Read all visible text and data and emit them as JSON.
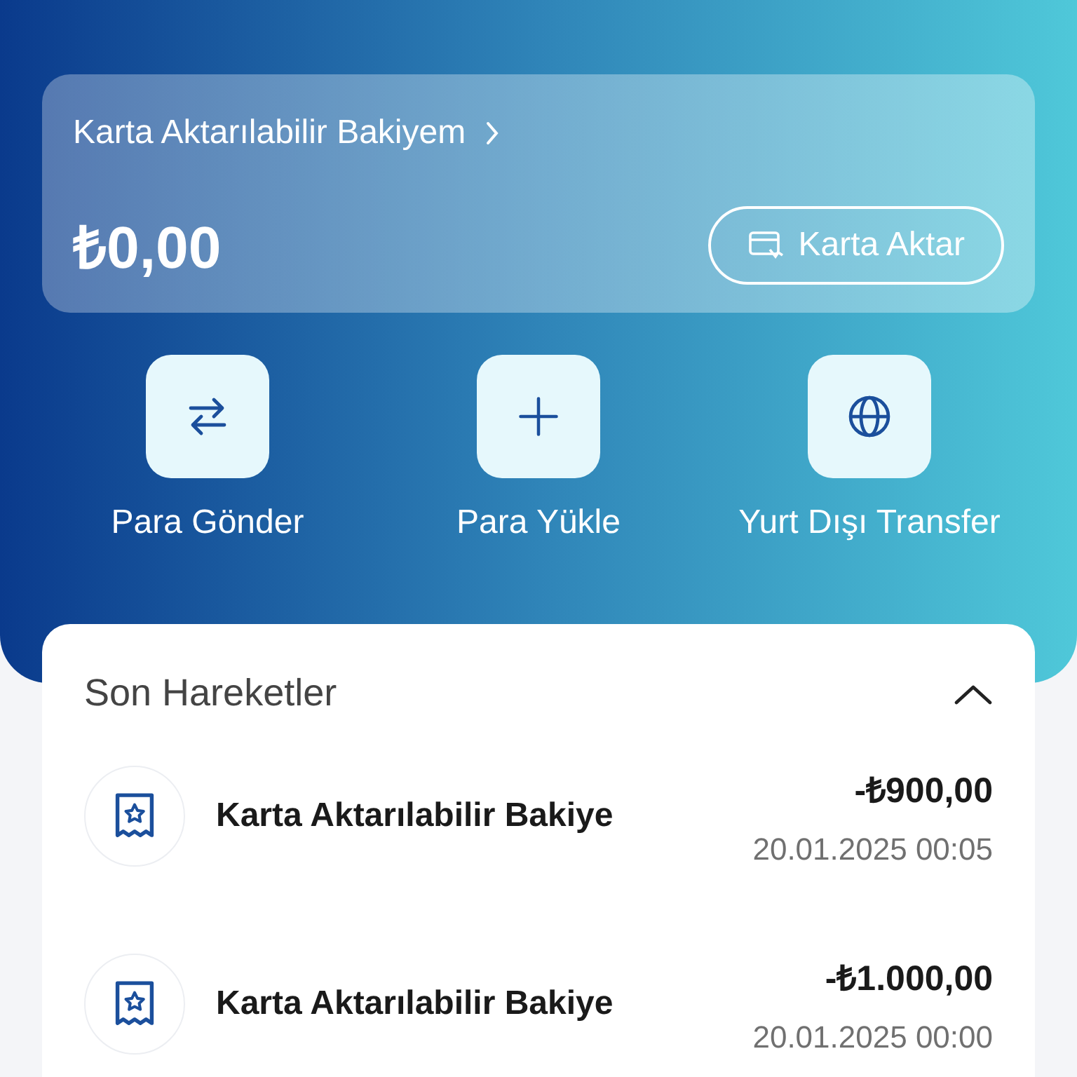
{
  "balance_card": {
    "title": "Karta Aktarılabilir Bakiyem",
    "amount": "₺0,00",
    "button": "Karta Aktar"
  },
  "actions": [
    {
      "kind": "swap",
      "label": "Para Gönder"
    },
    {
      "kind": "plus",
      "label": "Para Yükle"
    },
    {
      "kind": "globe",
      "label": "Yurt Dışı Transfer"
    }
  ],
  "recent": {
    "title": "Son Hareketler",
    "expanded": true,
    "items": [
      {
        "title": "Karta Aktarılabilir Bakiye",
        "amount": "-₺900,00",
        "date": "20.01.2025 00:05"
      },
      {
        "title": "Karta Aktarılabilir Bakiye",
        "amount": "-₺1.000,00",
        "date": "20.01.2025 00:00"
      }
    ]
  }
}
